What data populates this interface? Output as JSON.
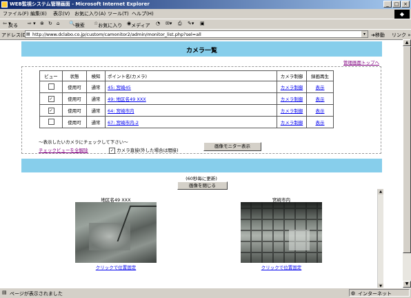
{
  "window": {
    "title": "WEB監視システム管理画面 - Microsoft Internet Explorer"
  },
  "menu": [
    "ファイル(F)",
    "編集(E)",
    "表示(V)",
    "お気に入り(A)",
    "ツール(T)",
    "ヘルプ(H)"
  ],
  "toolbar": {
    "back": "戻る",
    "search": "検索",
    "favorites": "お気に入り",
    "media": "メディア"
  },
  "address": {
    "label": "アドレス(D)",
    "url": "http://www.dclabo.co.jp/custom/camonitor2/admin/monitor_list.php?sel=all",
    "go": "移動",
    "links": "リンク"
  },
  "page": {
    "title": "カメラ一覧",
    "top_link": "管理画面トップへ",
    "headers": [
      "ビュー",
      "状態",
      "検知",
      "ポイント名(カメラ)",
      "カメラ制御",
      "録画再生"
    ],
    "rows": [
      {
        "checked": "",
        "status": "使用可",
        "detect": "通常",
        "point": "45: 宮崎45",
        "control": "カメラ制御",
        "play": "表示"
      },
      {
        "checked": "✓",
        "status": "使用可",
        "detect": "通常",
        "point": "49: 地区名49 XXX",
        "control": "カメラ制御",
        "play": "表示"
      },
      {
        "checked": "✓",
        "status": "使用可",
        "detect": "通常",
        "point": "64: 宮崎市内",
        "control": "カメラ制御",
        "play": "表示"
      },
      {
        "checked": "",
        "status": "使用可",
        "detect": "通常",
        "point": "67: 宮崎市内-2",
        "control": "カメラ制御",
        "play": "表示"
      }
    ],
    "hint": "～表示したいカメラにチェックして下さい～",
    "clear_all": "チェックビューを全解除",
    "direct_check": "✓",
    "direct_label": "カメラ直接(外した場合は間接)",
    "monitor_button": "画像モニター表示",
    "refresh_note": "(60秒毎に更新)",
    "close_button": "画像を閉じる",
    "cameras": [
      {
        "name": "地区名49 XXX",
        "link": "クリックで位置固定"
      },
      {
        "name": "宮崎市内",
        "link": "クリックで位置固定"
      }
    ]
  },
  "status": {
    "text": "ページが表示されました",
    "zone": "インターネット"
  }
}
